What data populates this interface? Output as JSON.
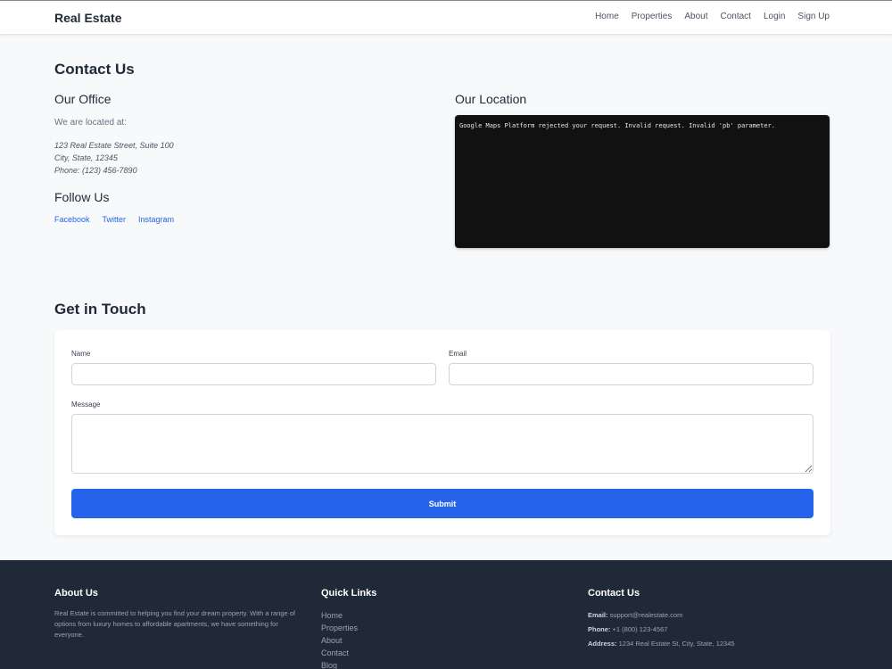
{
  "header": {
    "brand": "Real Estate",
    "nav": [
      "Home",
      "Properties",
      "About",
      "Contact",
      "Login",
      "Sign Up"
    ]
  },
  "contact": {
    "title": "Contact Us",
    "office": {
      "heading": "Our Office",
      "intro": "We are located at:",
      "address_line1": "123 Real Estate Street, Suite 100",
      "address_line2": "City, State, 12345",
      "phone": "Phone: (123) 456-7890"
    },
    "follow": {
      "heading": "Follow Us",
      "links": [
        "Facebook",
        "Twitter",
        "Instagram"
      ]
    },
    "location": {
      "heading": "Our Location",
      "error": "Google Maps Platform rejected your request. Invalid request. Invalid 'pb' parameter."
    }
  },
  "form": {
    "title": "Get in Touch",
    "name_label": "Name",
    "name_value": "",
    "email_label": "Email",
    "email_value": "",
    "message_label": "Message",
    "message_value": "",
    "submit_label": "Submit"
  },
  "footer": {
    "about_title": "About Us",
    "about_text": "Real Estate is committed to helping you find your dream property. With a range of options from luxury homes to affordable apartments, we have something for everyone.",
    "links_title": "Quick Links",
    "links": [
      "Home",
      "Properties",
      "About",
      "Contact",
      "Blog"
    ],
    "contact_title": "Contact Us",
    "email_label": "Email:",
    "email": "support@realestate.com",
    "phone_label": "Phone:",
    "phone": "+1 (800) 123-4567",
    "address_label": "Address:",
    "address": "1234 Real Estate St, City, State, 12345"
  },
  "colors": {
    "accent": "#2563eb",
    "footer_bg": "#1f2937",
    "page_bg": "#f7f9fb"
  }
}
